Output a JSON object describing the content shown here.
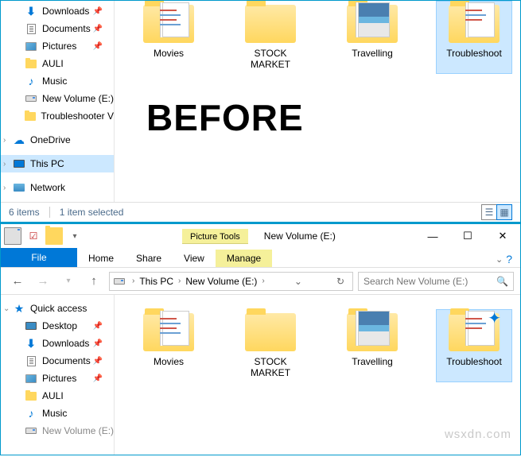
{
  "tree": {
    "downloads": "Downloads",
    "documents": "Documents",
    "pictures": "Pictures",
    "auli": "AULI",
    "music": "Music",
    "newvol": "New Volume (E:)",
    "troubleshooter": "Troubleshooter V",
    "onedrive": "OneDrive",
    "thispc": "This PC",
    "network": "Network",
    "quickaccess": "Quick access",
    "desktop": "Desktop"
  },
  "files": {
    "movies": "Movies",
    "stock": "STOCK MARKET",
    "travel": "Travelling",
    "trouble": "Troubleshoot"
  },
  "overlay": "BEFORE",
  "status": {
    "items": "6 items",
    "selected": "1 item selected"
  },
  "window": {
    "context_title": "Picture Tools",
    "title": "New Volume (E:)"
  },
  "tabs": {
    "file": "File",
    "home": "Home",
    "share": "Share",
    "view": "View",
    "manage": "Manage"
  },
  "address": {
    "thispc": "This PC",
    "newvol": "New Volume (E:)"
  },
  "search": {
    "placeholder": "Search New Volume (E:)"
  },
  "watermark": "wsxdn.com"
}
